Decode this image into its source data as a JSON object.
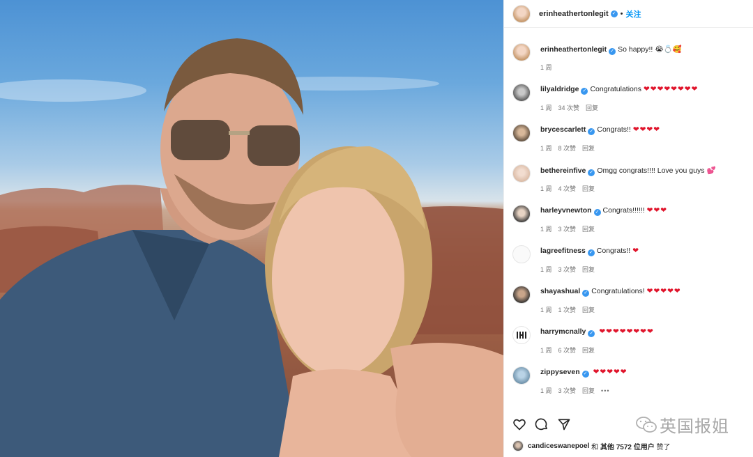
{
  "post": {
    "author": "erinheathertonlegit",
    "follow_label": "关注",
    "separator": "•"
  },
  "caption": {
    "author": "erinheathertonlegit",
    "text": "So happy!!",
    "emoji": "😭💍🥰",
    "time": "1 周"
  },
  "comments": [
    {
      "user": "lilyaldridge",
      "text": "Congratulations",
      "emoji": "❤❤❤❤❤❤❤❤",
      "time": "1 周",
      "likes": "34 次赞",
      "reply": "回复"
    },
    {
      "user": "brycescarlett",
      "text": "Congrats!!",
      "emoji": "❤❤❤❤",
      "time": "1 周",
      "likes": "8 次赞",
      "reply": "回复"
    },
    {
      "user": "bethereinfive",
      "text": "Omgg congrats!!!! Love you guys",
      "emoji": "💕",
      "time": "1 周",
      "likes": "4 次赞",
      "reply": "回复"
    },
    {
      "user": "harleyvnewton",
      "text": "Congrats!!!!!!",
      "emoji": "❤❤❤",
      "time": "1 周",
      "likes": "3 次赞",
      "reply": "回复"
    },
    {
      "user": "lagreefitness",
      "text": "Congrats!!",
      "emoji": "❤",
      "time": "1 周",
      "likes": "3 次赞",
      "reply": "回复"
    },
    {
      "user": "shayashual",
      "text": "Congratulations!",
      "emoji": "❤❤❤❤❤",
      "time": "1 周",
      "likes": "1 次赞",
      "reply": "回复"
    },
    {
      "user": "harrymcnally",
      "text": "",
      "emoji": "❤❤❤❤❤❤❤❤",
      "time": "1 周",
      "likes": "6 次赞",
      "reply": "回复"
    },
    {
      "user": "zippyseven",
      "text": "",
      "emoji": "❤❤❤❤❤",
      "time": "1 周",
      "likes": "3 次赞",
      "reply": "回复",
      "more": "•••"
    }
  ],
  "watermark": "英国报姐",
  "liked_by": {
    "user": "candiceswanepoel",
    "conj": " 和 ",
    "others": "其他 7572 位用户",
    "suffix": " 赞了"
  },
  "icons": [
    "heart-icon",
    "comment-icon",
    "share-icon",
    "verified-icon",
    "wechat-icon"
  ],
  "colors": {
    "link": "#0095f6",
    "verified": "#3897f0",
    "heart": "#e0142b",
    "muted": "#737373"
  }
}
